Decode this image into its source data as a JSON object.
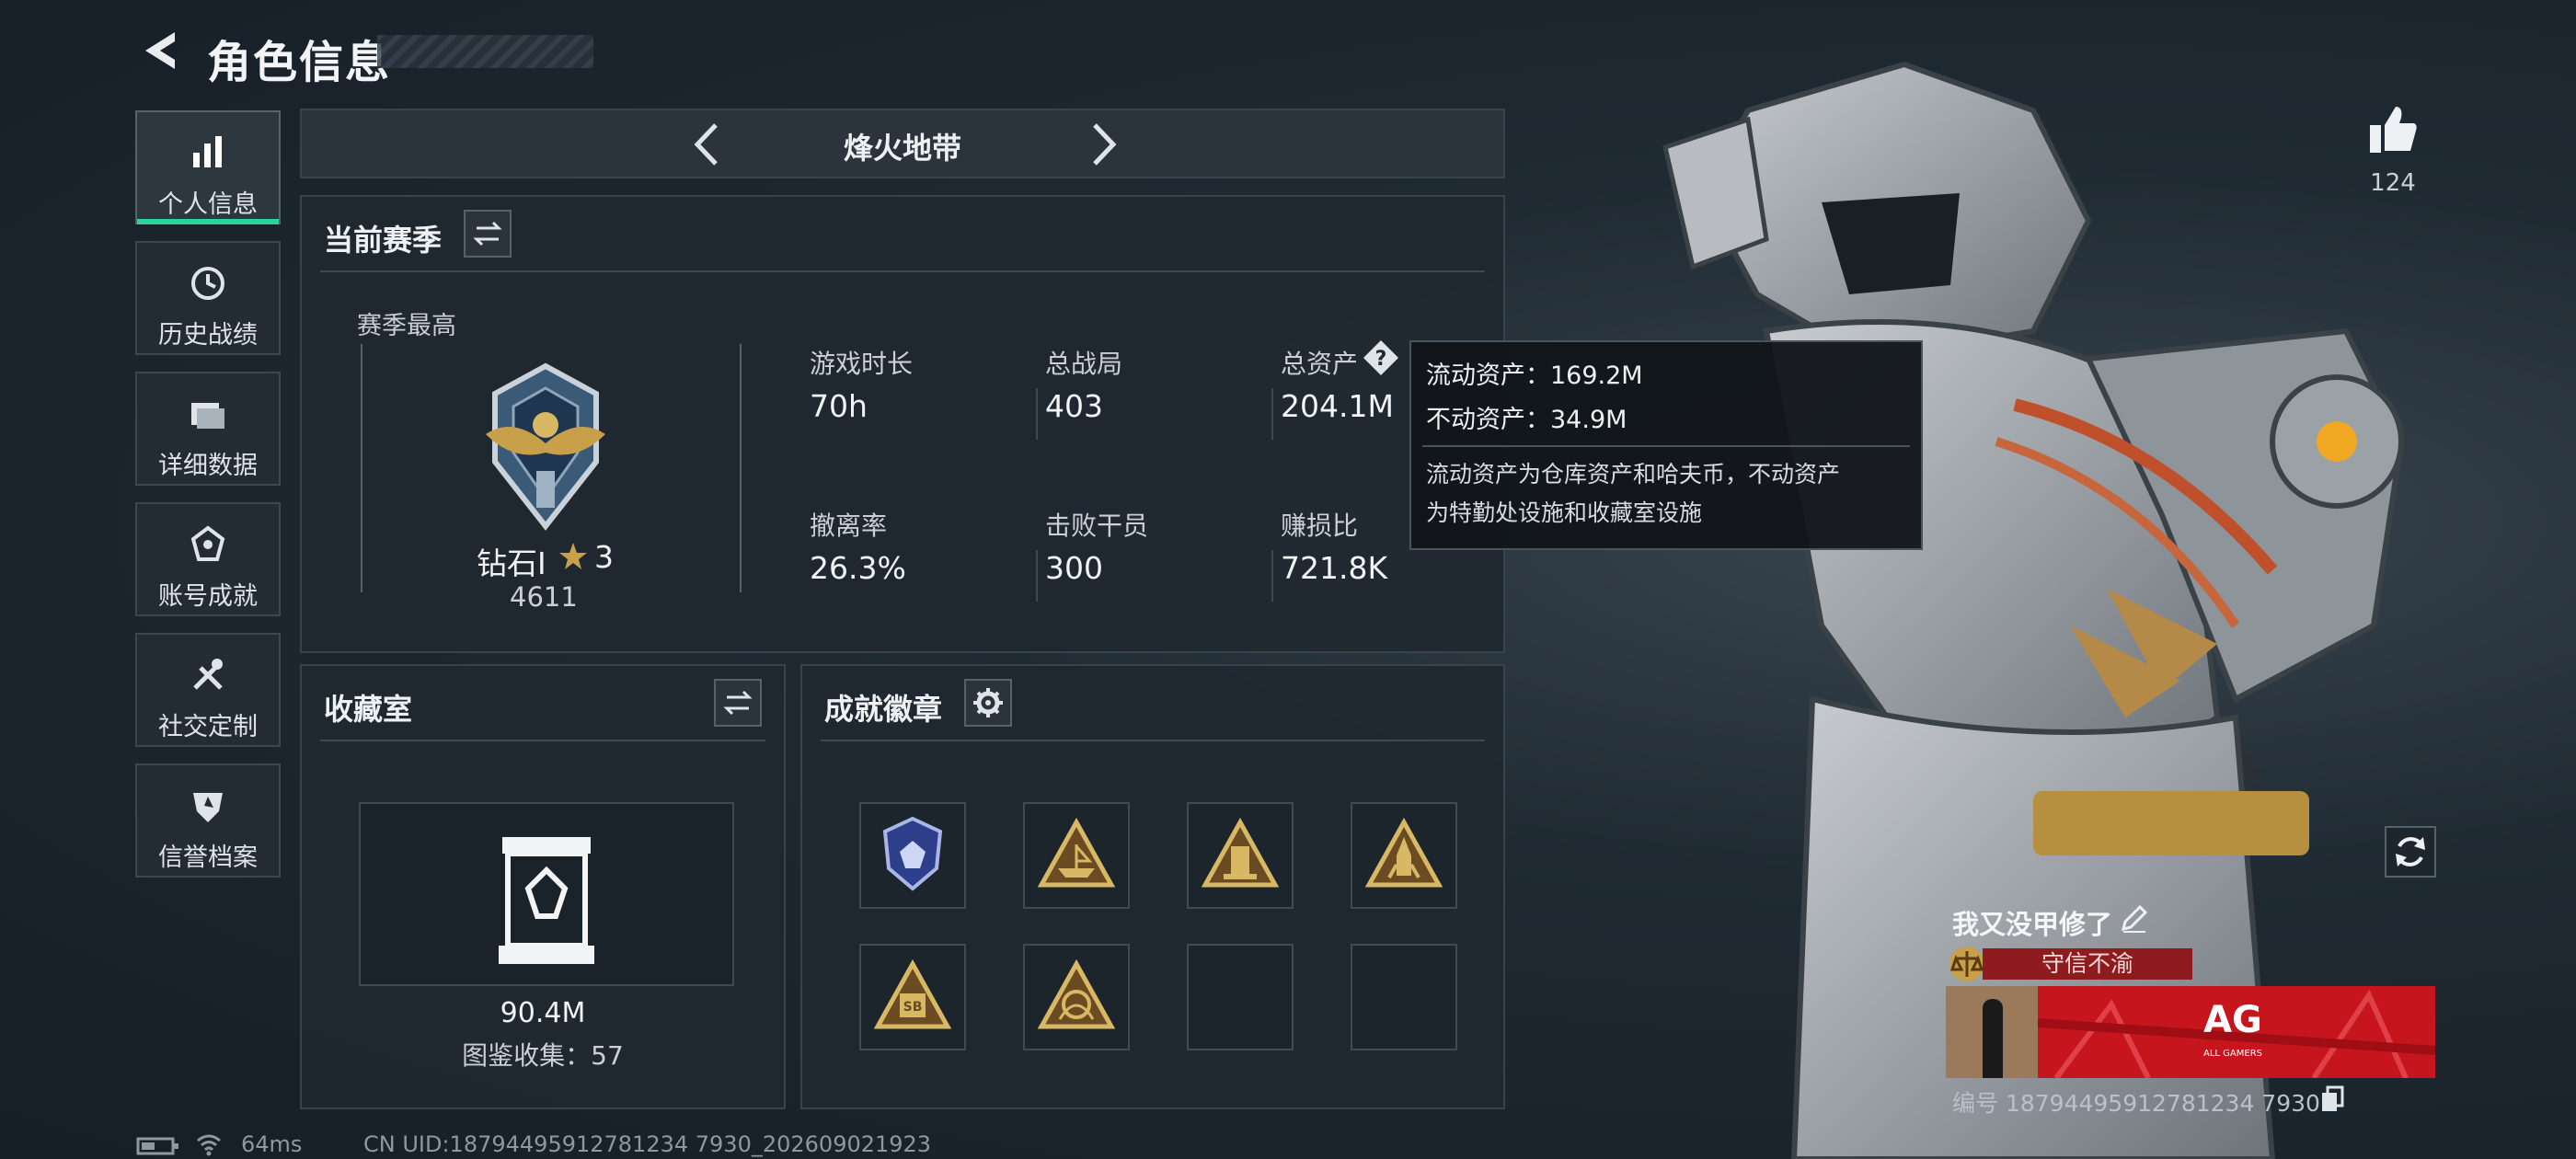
{
  "header": {
    "title": "角色信息"
  },
  "sidebar": {
    "items": [
      {
        "label": "个人信息",
        "icon": "bar-chart-icon",
        "active": true
      },
      {
        "label": "历史战绩",
        "icon": "history-icon",
        "active": false
      },
      {
        "label": "详细数据",
        "icon": "folder-icon",
        "active": false
      },
      {
        "label": "账号成就",
        "icon": "achievement-icon",
        "active": false
      },
      {
        "label": "社交定制",
        "icon": "tools-icon",
        "active": false
      },
      {
        "label": "信誉档案",
        "icon": "shield-icon",
        "active": false
      }
    ]
  },
  "mode": {
    "name": "烽火地带"
  },
  "season": {
    "title": "当前赛季",
    "best_label": "赛季最高",
    "rank_name": "钻石I",
    "rank_stars": "3",
    "rank_points": "4611",
    "stats": [
      {
        "label": "游戏时长",
        "value": "70h"
      },
      {
        "label": "总战局",
        "value": "403"
      },
      {
        "label": "总资产",
        "value": "204.1M"
      },
      {
        "label": "撤离率",
        "value": "26.3%"
      },
      {
        "label": "击败干员",
        "value": "300"
      },
      {
        "label": "赚损比",
        "value": "721.8K"
      }
    ]
  },
  "tooltip": {
    "liquid": "流动资产：169.2M",
    "fixed": "不动资产：34.9M",
    "desc_line1": "流动资产为仓库资产和哈夫币，不动资产",
    "desc_line2": "为特勤处设施和收藏室设施"
  },
  "collection": {
    "title": "收藏室",
    "value": "90.4M",
    "count_text": "图鉴收集：57"
  },
  "badges": {
    "title": "成就徽章",
    "slots": [
      {
        "icon": "blue-shield-badge-icon"
      },
      {
        "icon": "ship-badge-icon"
      },
      {
        "icon": "tower-badge-icon"
      },
      {
        "icon": "rocket-badge-icon"
      },
      {
        "icon": "sb-badge-icon"
      },
      {
        "icon": "emblem-badge-icon"
      },
      {
        "icon": ""
      },
      {
        "icon": ""
      }
    ]
  },
  "likes": {
    "count": "124"
  },
  "player": {
    "name": "我又没甲修了",
    "title_tag": "守信不渝",
    "banner_logo": "AG",
    "banner_sub": "ALL GAMERS",
    "id_text": "编号 18794495912781234 7930"
  },
  "footer": {
    "ping": "64ms",
    "uid": "CN UID:18794495912781234 7930_202609021923"
  },
  "colors": {
    "accent": "#2fd39a",
    "tag_red": "#8e1c1f",
    "banner_red": "#c7151d",
    "gold": "#c9a04a"
  }
}
